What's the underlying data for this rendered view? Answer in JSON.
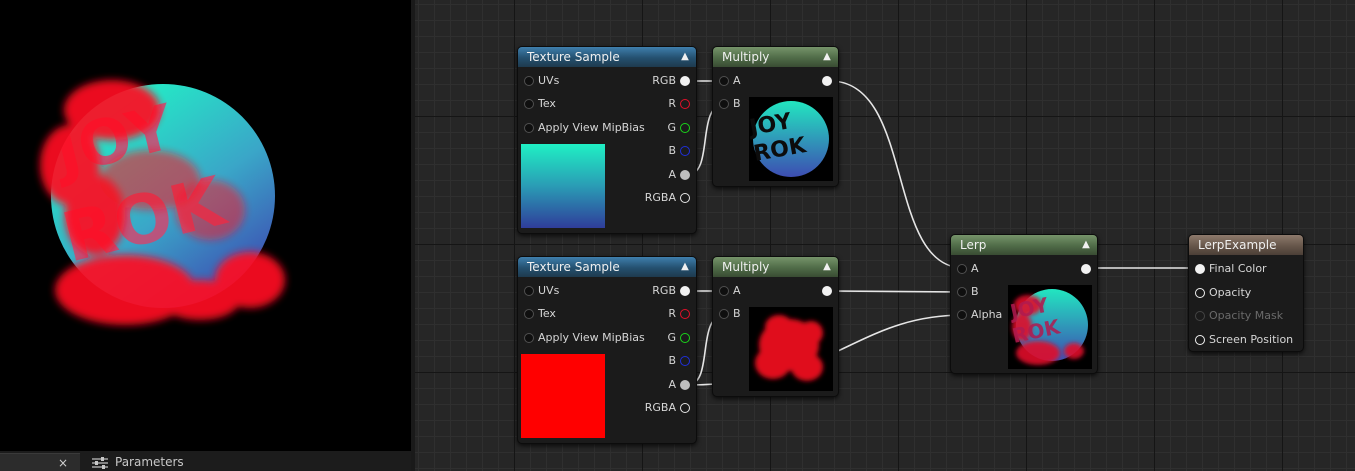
{
  "tabs": {
    "preview_close": "×",
    "parameters": "Parameters"
  },
  "nodes": {
    "texture_sample_1": {
      "title": "Texture Sample",
      "inputs": [
        "UVs",
        "Tex",
        "Apply View MipBias"
      ],
      "outputs": [
        "RGB",
        "R",
        "G",
        "B",
        "A",
        "RGBA"
      ],
      "preview_top": "#1ff0c4",
      "preview_bottom": "#2f3d9a"
    },
    "multiply_1": {
      "title": "Multiply",
      "inputs": [
        "A",
        "B"
      ],
      "preview_text": "JOY ROK"
    },
    "texture_sample_2": {
      "title": "Texture Sample",
      "inputs": [
        "UVs",
        "Tex",
        "Apply View MipBias"
      ],
      "outputs": [
        "RGB",
        "R",
        "G",
        "B",
        "A",
        "RGBA"
      ],
      "preview_color": "#ff0000"
    },
    "multiply_2": {
      "title": "Multiply",
      "inputs": [
        "A",
        "B"
      ]
    },
    "lerp": {
      "title": "Lerp",
      "inputs": [
        "A",
        "B",
        "Alpha"
      ],
      "preview_text": "JOY ROK"
    },
    "result": {
      "title": "LerpExample",
      "inputs": [
        "Final Color",
        "Opacity",
        "Opacity Mask",
        "Screen Position"
      ]
    }
  },
  "viewport": {
    "logo_text_top": "JOY",
    "logo_text_bottom": "ROK",
    "accent_teal": "#22e6c0",
    "accent_blue": "#3a4fb0",
    "accent_red": "#ff1020"
  },
  "colors": {
    "pin_red": "#e0102a",
    "pin_green": "#1ad31a",
    "pin_blue": "#1f2fd8"
  }
}
